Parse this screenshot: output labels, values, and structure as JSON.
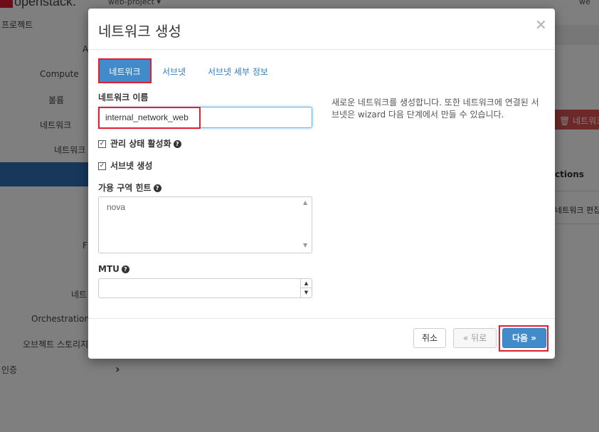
{
  "background": {
    "logo_text": "openstack.",
    "project": "web-project ▾",
    "user": "we",
    "sidebar": [
      {
        "label": "프로젝트"
      },
      {
        "label": "A"
      },
      {
        "label": "Compute"
      },
      {
        "label": "볼륨"
      },
      {
        "label": "네트워크"
      },
      {
        "label": "네트워크"
      },
      {
        "label": "F"
      },
      {
        "label": "네트"
      },
      {
        "label": "Orchestration"
      },
      {
        "label": "오브젝트 스토리지"
      },
      {
        "label": "인증"
      },
      {
        "label": "›"
      }
    ],
    "right_delete": "🗑 네트워크",
    "right_actions": "ctions",
    "right_edit": "네트워크 편집"
  },
  "modal": {
    "title": "네트워크 생성",
    "close": "×",
    "tabs": [
      {
        "label": "네트워크",
        "active": true
      },
      {
        "label": "서브넷"
      },
      {
        "label": "서브넷 세부 정보"
      }
    ],
    "network_name_label": "네트워크 이름",
    "network_name_value": "internal_network_web",
    "admin_state_label": "관리 상태 활성화",
    "create_subnet_label": "서브넷 생성",
    "az_hint_label": "가용 구역 힌트",
    "az_hint_value": "nova",
    "mtu_label": "MTU",
    "mtu_value": "",
    "description": "새로운 네트워크를 생성합니다. 또한 네트워크에 연결된 서브넷은 wizard 다음 단계에서 만들 수 있습니다.",
    "buttons": {
      "cancel": "취소",
      "back": "« 뒤로",
      "next": "다음 »"
    }
  }
}
